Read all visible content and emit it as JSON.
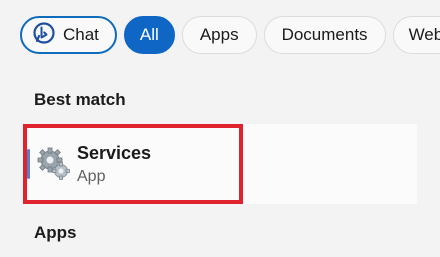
{
  "filters": {
    "chat_label": "Chat",
    "all_label": "All",
    "apps_label": "Apps",
    "documents_label": "Documents",
    "web_label": "Web",
    "active": "All"
  },
  "best_match": {
    "heading": "Best match",
    "result": {
      "title": "Services",
      "subtitle": "App",
      "icon": "services-gears-icon"
    }
  },
  "apps": {
    "heading": "Apps"
  },
  "colors": {
    "accent": "#0f66c4",
    "highlight": "#e0242f"
  }
}
